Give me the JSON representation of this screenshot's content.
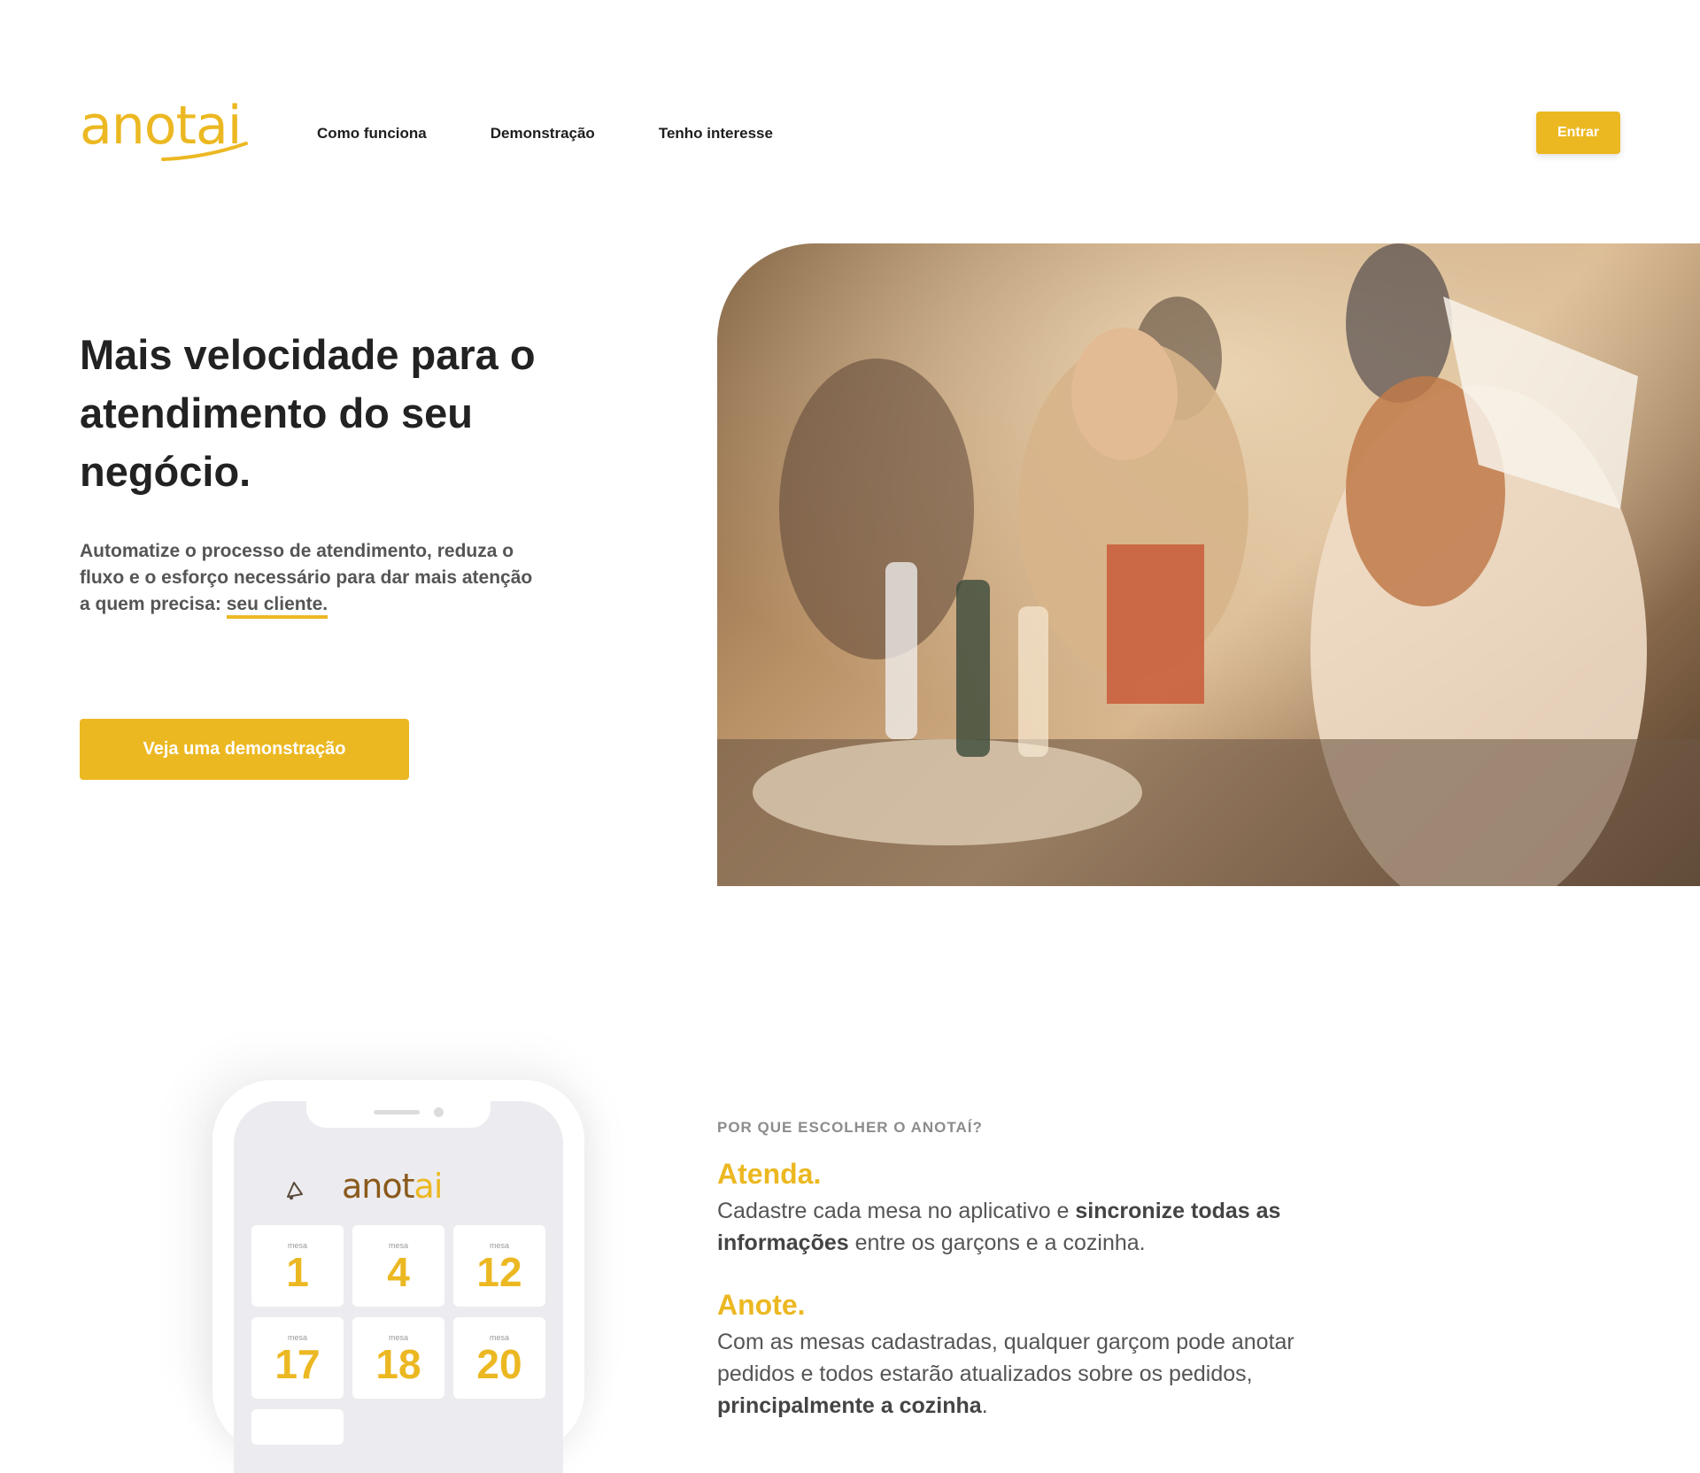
{
  "brand": {
    "name": "anotai",
    "accent": "#ecb822"
  },
  "nav": {
    "items": [
      "Como funciona",
      "Demonstração",
      "Tenho interesse"
    ]
  },
  "header": {
    "enter_label": "Entrar"
  },
  "hero": {
    "title": "Mais velocidade para o atendimento do seu negócio.",
    "subtitle_prefix": "Automatize o processo de atendimento, reduza o fluxo e o esforço necessário para dar mais atenção a quem precisa: ",
    "subtitle_highlight": "seu cliente.",
    "cta_label": "Veja uma demonstração"
  },
  "phone": {
    "logo_main": "anot",
    "logo_accent": "ai",
    "bell_icon": "bell-icon",
    "tiles": [
      {
        "label": "mesa",
        "number": "1"
      },
      {
        "label": "mesa",
        "number": "4"
      },
      {
        "label": "mesa",
        "number": "12"
      },
      {
        "label": "mesa",
        "number": "17"
      },
      {
        "label": "mesa",
        "number": "18"
      },
      {
        "label": "mesa",
        "number": "20"
      }
    ]
  },
  "features": {
    "eyebrow": "POR QUE ESCOLHER O ANOTAÍ?",
    "items": [
      {
        "title": "Atenda.",
        "text_1": "Cadastre cada mesa no aplicativo e ",
        "bold_1": "sincronize todas as informações",
        "text_2": " entre os garçons e a cozinha."
      },
      {
        "title": "Anote.",
        "text_1": "Com as mesas cadastradas, qualquer garçom pode anotar pedidos e todos estarão atualizados sobre os pedidos, ",
        "bold_1": "principalmente a cozinha",
        "text_2": "."
      }
    ]
  }
}
